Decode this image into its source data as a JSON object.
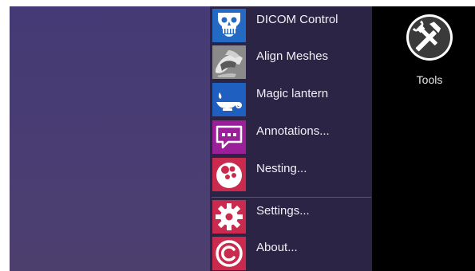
{
  "menu": {
    "items": [
      {
        "label": "DICOM Control",
        "icon": "skull-icon",
        "color": "#2469c4"
      },
      {
        "label": "Align Meshes",
        "icon": "meshes-icon",
        "color": "#8a8a8a"
      },
      {
        "label": "Magic lantern",
        "icon": "lamp-icon",
        "color": "#1f5fc0"
      },
      {
        "label": "Annotations...",
        "icon": "speech-bubble-icon",
        "color": "#9c1f9a"
      },
      {
        "label": "Nesting...",
        "icon": "nesting-circles-icon",
        "color": "#c92a4d"
      },
      {
        "label": "Settings...",
        "icon": "gear-icon",
        "color": "#c92a4d"
      },
      {
        "label": "About...",
        "icon": "copyright-icon",
        "color": "#c92a4d"
      }
    ]
  },
  "toolbar": {
    "tools_label": "Tools",
    "tools_icon": "tools-icon"
  }
}
